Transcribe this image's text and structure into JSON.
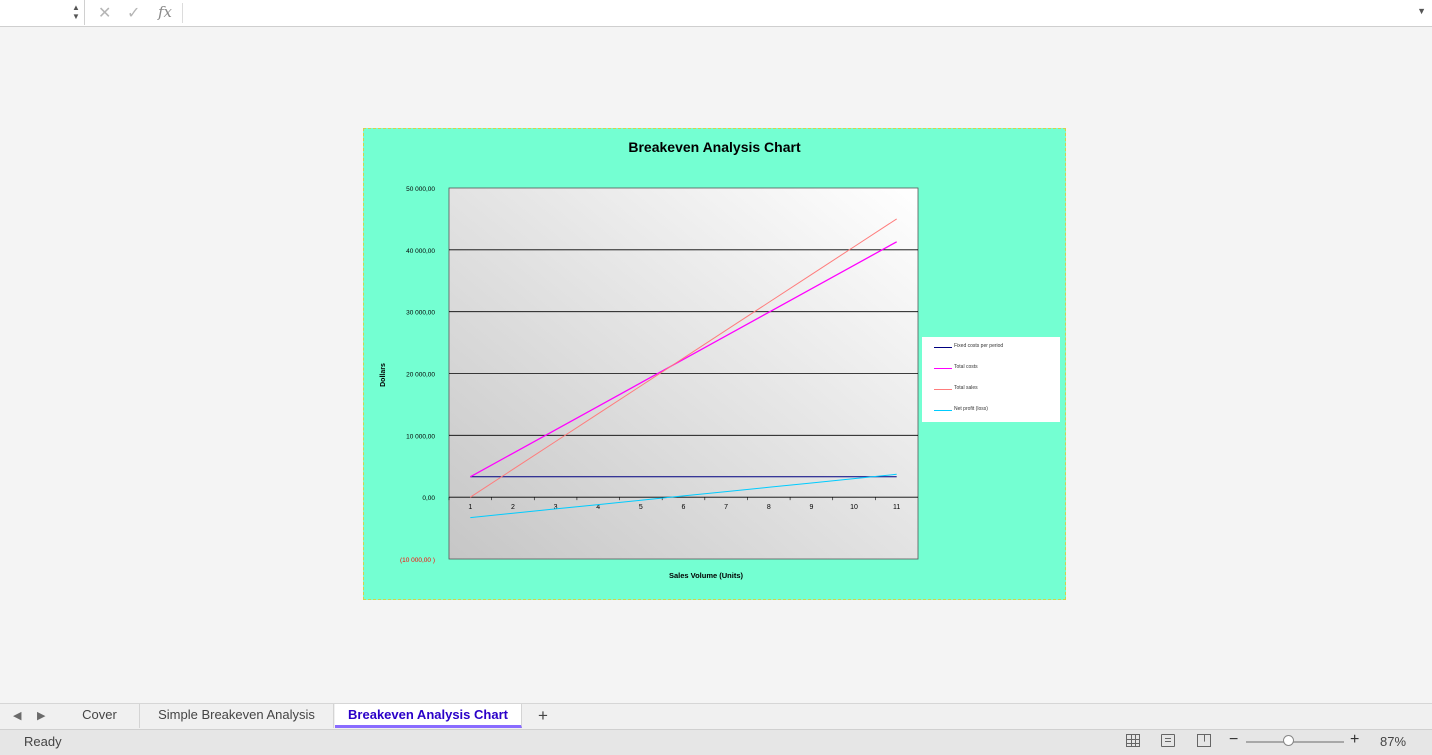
{
  "formula_bar": {
    "name_box": "",
    "formula": ""
  },
  "chart_data": {
    "type": "line",
    "title": "Breakeven Analysis Chart",
    "xlabel": "Sales Volume (Units)",
    "ylabel": "Dollars",
    "categories": [
      "1",
      "2",
      "3",
      "4",
      "5",
      "6",
      "7",
      "8",
      "9",
      "10",
      "11"
    ],
    "ylim": [
      -10000,
      50000
    ],
    "yticks": [
      {
        "value": 50000,
        "label": "50 000,00"
      },
      {
        "value": 40000,
        "label": "40 000,00"
      },
      {
        "value": 30000,
        "label": "30 000,00"
      },
      {
        "value": 20000,
        "label": "20 000,00"
      },
      {
        "value": 10000,
        "label": "10 000,00"
      },
      {
        "value": 0,
        "label": "0,00"
      },
      {
        "value": -10000,
        "label": "(10 000,00 )"
      }
    ],
    "grid": true,
    "legend_position": "right",
    "series": [
      {
        "name": "Fixed costs per period",
        "color": "#000080",
        "values": [
          3300,
          3300,
          3300,
          3300,
          3300,
          3300,
          3300,
          3300,
          3300,
          3300,
          3300
        ]
      },
      {
        "name": "Total costs",
        "color": "#ff00ff",
        "values": [
          3300,
          7100,
          10900,
          14700,
          18500,
          22300,
          26100,
          29900,
          33700,
          37500,
          41300
        ]
      },
      {
        "name": "Total sales",
        "color": "#ff7c7c",
        "values": [
          0,
          4500,
          9000,
          13500,
          18000,
          22500,
          27000,
          31500,
          36000,
          40500,
          45000
        ]
      },
      {
        "name": "Net profit (loss)",
        "color": "#00ccff",
        "values": [
          -3300,
          -2600,
          -1900,
          -1200,
          -500,
          200,
          900,
          1600,
          2300,
          3000,
          3700
        ]
      }
    ]
  },
  "sheet_tabs": [
    {
      "label": "Cover",
      "active": false
    },
    {
      "label": "Simple Breakeven Analysis",
      "active": false
    },
    {
      "label": "Breakeven Analysis Chart",
      "active": true
    }
  ],
  "tab_add_label": "+",
  "status": {
    "text": "Ready",
    "zoom": "87%"
  },
  "colors": {
    "chart_background": "#74ffd2",
    "active_tab_text": "#2a00c8",
    "active_tab_underline": "#8a6cff"
  }
}
